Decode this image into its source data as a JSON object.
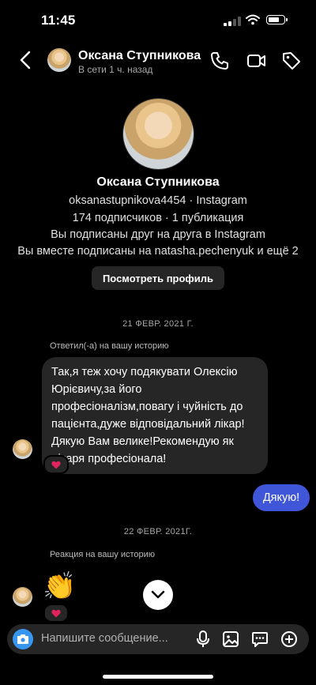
{
  "status_bar": {
    "time": "11:45"
  },
  "header": {
    "name": "Оксана Ступникова",
    "status": "В сети 1 ч. назад"
  },
  "profile": {
    "name": "Оксана Ступникова",
    "handle_line": "oksanastupnikova4454 · Instagram",
    "stats_line": "174 подписчиков · 1 публикация",
    "mutual_line": "Вы подписаны друг на друга в Instagram",
    "common_line": "Вы вместе подписаны на natasha.pechenyuk и ещё 2",
    "button": "Посмотреть профиль"
  },
  "messages": {
    "date1": "21 ФЕВР. 2021 Г.",
    "reply_label": "Ответил(-а) на вашу историю",
    "incoming_text": "Так,я теж хочу подякувати Олексію Юрієвичу,за його професіоналізм,повагу  і чуйність до пацієнта,дуже відповідальний лікар! Дякую Вам велике!Рекомендую як лікаря професіонала!",
    "outgoing_text": "Дякую!",
    "date2": "22 ФЕВР. 2021Г.",
    "reaction_label": "Реакция на вашу историю",
    "reaction_emoji": "👏"
  },
  "composer": {
    "placeholder": "Напишите сообщение..."
  },
  "colors": {
    "accent_outgoing": "#3f56d9",
    "camera": "#3797f0",
    "heart": "#e0245e",
    "bubble": "#262626"
  }
}
